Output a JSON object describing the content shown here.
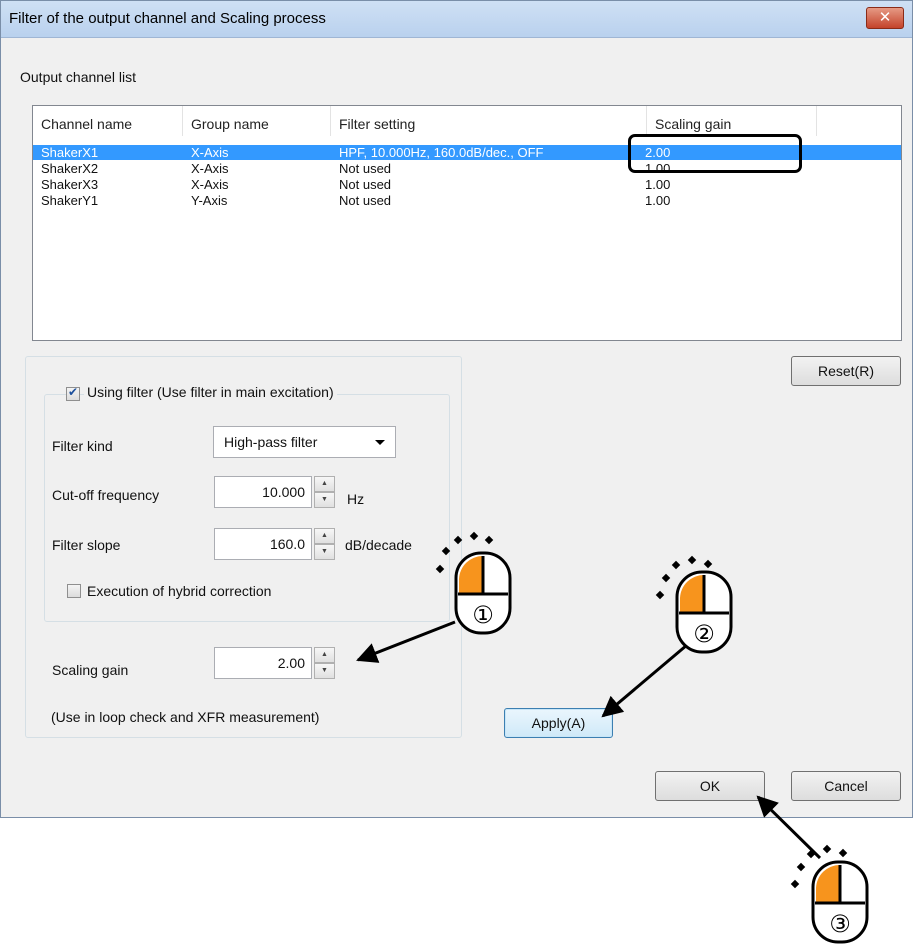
{
  "window": {
    "title": "Filter of the output channel and Scaling process",
    "close_glyph": "✕"
  },
  "output_list": {
    "label": "Output channel list",
    "columns": [
      "Channel name",
      "Group name",
      "Filter setting",
      "Scaling gain"
    ],
    "rows": [
      {
        "channel": "ShakerX1",
        "group": "X-Axis",
        "filter": "HPF, 10.000Hz, 160.0dB/dec., OFF",
        "gain": "2.00",
        "selected": true
      },
      {
        "channel": "ShakerX2",
        "group": "X-Axis",
        "filter": "Not used",
        "gain": "1.00",
        "selected": false
      },
      {
        "channel": "ShakerX3",
        "group": "X-Axis",
        "filter": "Not used",
        "gain": "1.00",
        "selected": false
      },
      {
        "channel": "ShakerY1",
        "group": "Y-Axis",
        "filter": "Not used",
        "gain": "1.00",
        "selected": false
      }
    ]
  },
  "buttons": {
    "reset": "Reset(R)",
    "apply": "Apply(A)",
    "ok": "OK",
    "cancel": "Cancel"
  },
  "filter": {
    "use_filter_label": "Using filter (Use filter in main excitation)",
    "use_filter_checked": true,
    "kind_label": "Filter kind",
    "kind_value": "High-pass filter",
    "cutoff_label": "Cut-off frequency",
    "cutoff_value": "10.000",
    "cutoff_unit": "Hz",
    "slope_label": "Filter slope",
    "slope_value": "160.0",
    "slope_unit": "dB/decade",
    "hybrid_label": "Execution of hybrid correction",
    "hybrid_checked": false
  },
  "scaling": {
    "label": "Scaling gain",
    "value": "2.00",
    "note": "(Use in loop check and XFR measurement)"
  },
  "annotations": {
    "step1": "①",
    "step2": "②",
    "step3": "③",
    "mouse_accent": "#f7941d"
  }
}
